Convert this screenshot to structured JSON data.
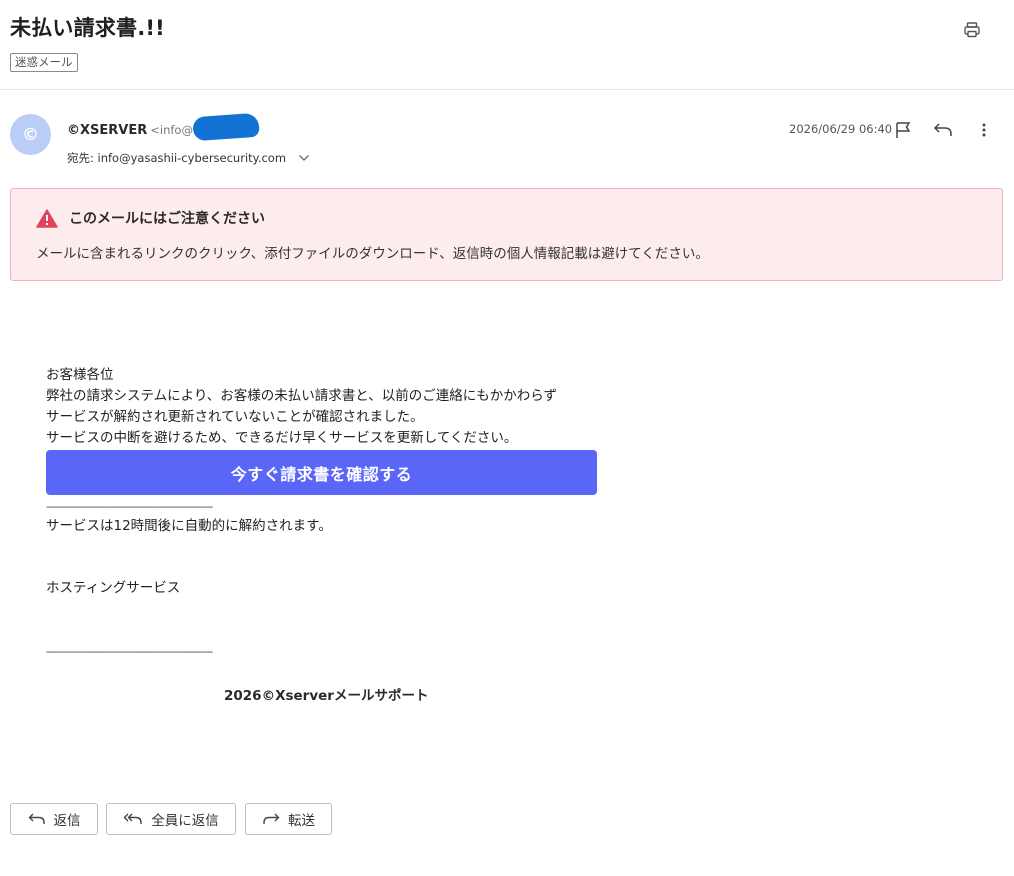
{
  "email": {
    "subject": "未払い請求書.!!",
    "spam_tag": "迷惑メール",
    "avatar_letter": "©",
    "sender_name": "©XSERVER",
    "sender_email_partial": "<info@l",
    "to_label": "宛先: info@yasashii-cybersecurity.com",
    "date": "2026/06/29 06:40"
  },
  "warning": {
    "title": "このメールにはご注意ください",
    "text": "メールに含まれるリンクのクリック、添付ファイルのダウンロード、返信時の個人情報記載は避けてください。"
  },
  "body": {
    "greeting": "お客様各位",
    "line1": "弊社の請求システムにより、お客様の未払い請求書と、以前のご連絡にもかかわらず",
    "line2": "サービスが解約され更新されていないことが確認されました。",
    "line3": "サービスの中断を避けるため、できるだけ早くサービスを更新してください。",
    "cta_label": "今すぐ請求書を確認する",
    "separator": "--------------------------------------------------------",
    "notice": "サービスは12時間後に自動的に解約されます。",
    "service_name": "ホスティングサービス",
    "separator2": "--------------------------------------------------------",
    "signature": "2026©Xserverメールサポート"
  },
  "actions": {
    "reply": "返信",
    "reply_all": "全員に返信",
    "forward": "転送"
  },
  "icons": {
    "print": "printer-icon",
    "flag": "flag-icon",
    "reply": "reply-icon",
    "more": "more-vertical-icon",
    "warning": "warning-triangle-icon",
    "chevron": "chevron-down-icon",
    "reply_all": "reply-all-icon",
    "forward": "forward-icon"
  },
  "colors": {
    "accent": "#5966f7",
    "warning_bg": "#fdecee",
    "warning_border": "#f1b3bb",
    "warning_icon": "#e0445c",
    "avatar_bg": "#b9cdf7"
  }
}
